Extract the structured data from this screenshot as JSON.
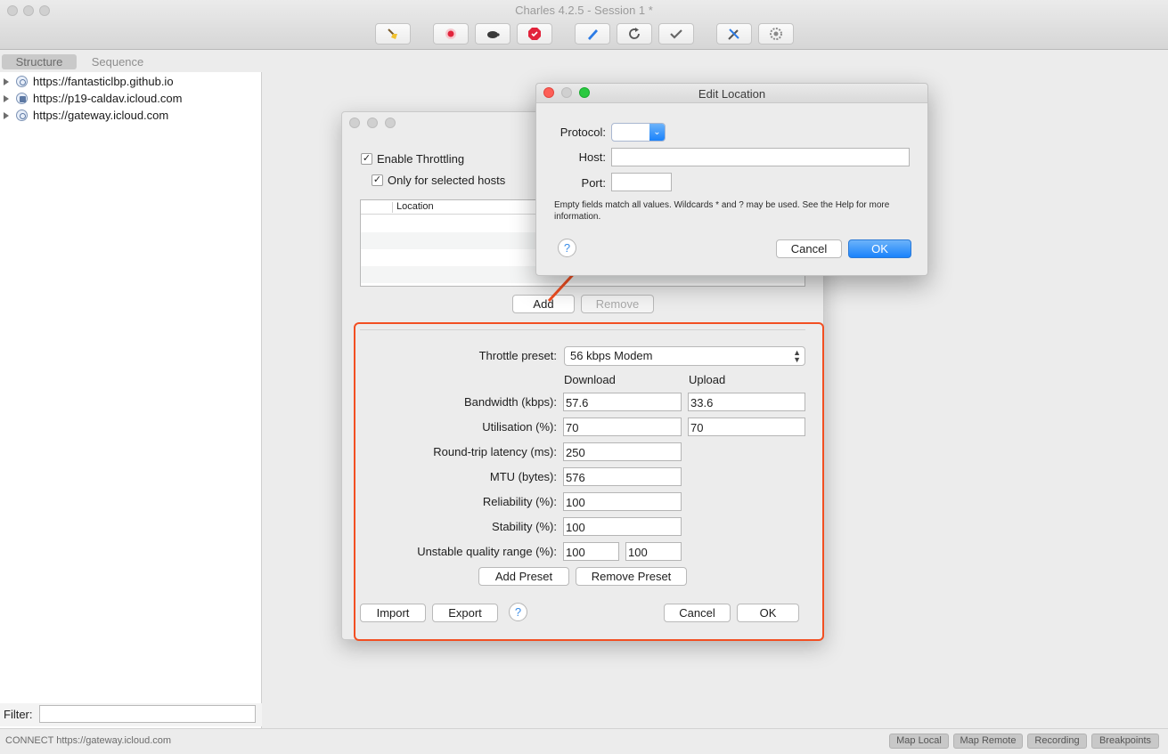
{
  "app": {
    "title": "Charles 4.2.5 - Session 1 *"
  },
  "toolbar": {
    "buttons": [
      {
        "name": "broom-icon"
      },
      {
        "name": "record-icon"
      },
      {
        "name": "turtle-throttle-icon"
      },
      {
        "name": "stop-breakpoints-icon"
      },
      {
        "name": "compose-pen-icon"
      },
      {
        "name": "repeat-icon"
      },
      {
        "name": "validate-check-icon"
      },
      {
        "name": "tools-icon"
      },
      {
        "name": "settings-gear-icon"
      }
    ]
  },
  "sidebar": {
    "tabs": [
      "Structure",
      "Sequence"
    ],
    "hosts": [
      "https://fantasticlbp.github.io",
      "https://p19-caldav.icloud.com",
      "https://gateway.icloud.com"
    ],
    "filter_label": "Filter:"
  },
  "status": {
    "text": "CONNECT https://gateway.icloud.com",
    "buttons": [
      "Map Local",
      "Map Remote",
      "Recording",
      "Breakpoints"
    ]
  },
  "throttle": {
    "enable_label": "Enable Throttling",
    "only_selected_label": "Only for selected hosts",
    "location_header": "Location",
    "add_label": "Add",
    "remove_label": "Remove",
    "preset_label": "Throttle preset:",
    "preset_value": "56 kbps Modem",
    "download_header": "Download",
    "upload_header": "Upload",
    "bandwidth_label": "Bandwidth (kbps):",
    "bandwidth_down": "57.6",
    "bandwidth_up": "33.6",
    "utilisation_label": "Utilisation (%):",
    "utilisation_down": "70",
    "utilisation_up": "70",
    "latency_label": "Round-trip latency (ms):",
    "latency": "250",
    "mtu_label": "MTU (bytes):",
    "mtu": "576",
    "reliability_label": "Reliability (%):",
    "reliability": "100",
    "stability_label": "Stability (%):",
    "stability": "100",
    "unstable_label": "Unstable quality range (%):",
    "unstable_min": "100",
    "unstable_max": "100",
    "add_preset_label": "Add Preset",
    "remove_preset_label": "Remove Preset",
    "import_label": "Import",
    "export_label": "Export",
    "help_glyph": "?",
    "cancel_label": "Cancel",
    "ok_label": "OK"
  },
  "edit_location": {
    "title": "Edit Location",
    "protocol_label": "Protocol:",
    "host_label": "Host:",
    "port_label": "Port:",
    "host_value": "",
    "port_value": "",
    "note": "Empty fields match all values. Wildcards * and ? may be used. See the Help for more information.",
    "help_glyph": "?",
    "cancel_label": "Cancel",
    "ok_label": "OK"
  },
  "colors": {
    "highlight_box": "#f24f22",
    "arrow": "#f24f22",
    "default_button": "#1a82fb"
  }
}
